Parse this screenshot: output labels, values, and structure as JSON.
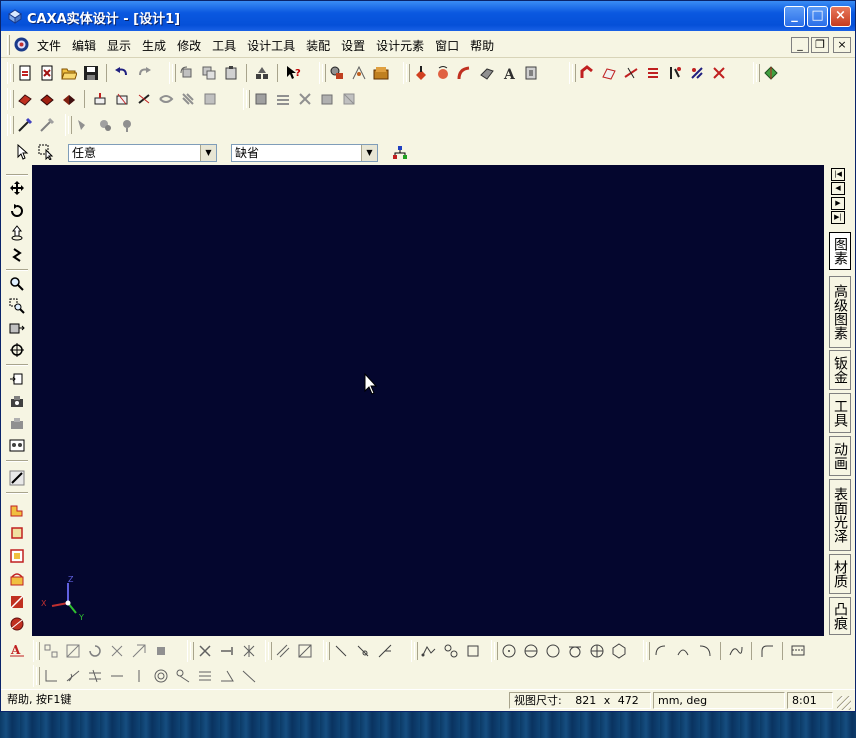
{
  "window": {
    "title": "CAXA实体设计 - [设计1]"
  },
  "menu": {
    "items": [
      "文件",
      "编辑",
      "显示",
      "生成",
      "修改",
      "工具",
      "设计工具",
      "装配",
      "设置",
      "设计元素",
      "窗口",
      "帮助"
    ]
  },
  "selectors": {
    "filter_value": "任意",
    "style_value": "缺省"
  },
  "right_tabs": [
    "图素",
    "高级图素",
    "钣金",
    "工具",
    "动画",
    "表面光泽",
    "材质",
    "凸痕"
  ],
  "status": {
    "help": "帮助, 按F1键",
    "view_size_label": "视图尺寸:",
    "view_width": "821",
    "view_x": "x",
    "view_height": "472",
    "units": "mm, deg",
    "time": "8:01"
  },
  "axis": {
    "x": "X",
    "y": "Y",
    "z": "Z"
  },
  "colors": {
    "viewport_bg": "#04062e",
    "titlebar": "#0550d8"
  }
}
